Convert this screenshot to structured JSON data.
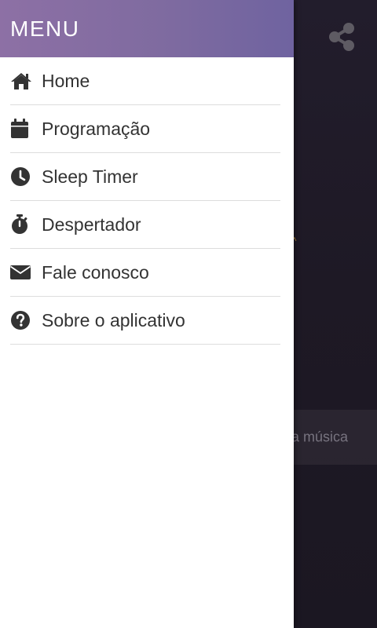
{
  "drawer": {
    "title": "MENU",
    "items": [
      {
        "label": "Home",
        "icon": "home-icon"
      },
      {
        "label": "Programação",
        "icon": "calendar-icon"
      },
      {
        "label": "Sleep Timer",
        "icon": "clock-icon"
      },
      {
        "label": "Despertador",
        "icon": "stopwatch-icon"
      },
      {
        "label": "Fale conosco",
        "icon": "envelope-icon"
      },
      {
        "label": "Sobre o aplicativo",
        "icon": "question-circle-icon"
      }
    ]
  },
  "background": {
    "share_icon": "share-icon",
    "song_text": "a música"
  },
  "colors": {
    "header_gradient_start": "#8d70a5",
    "header_gradient_end": "#6f63a0",
    "background": "#1f1a26",
    "menu_text": "#333333",
    "divider": "#dddddd"
  }
}
